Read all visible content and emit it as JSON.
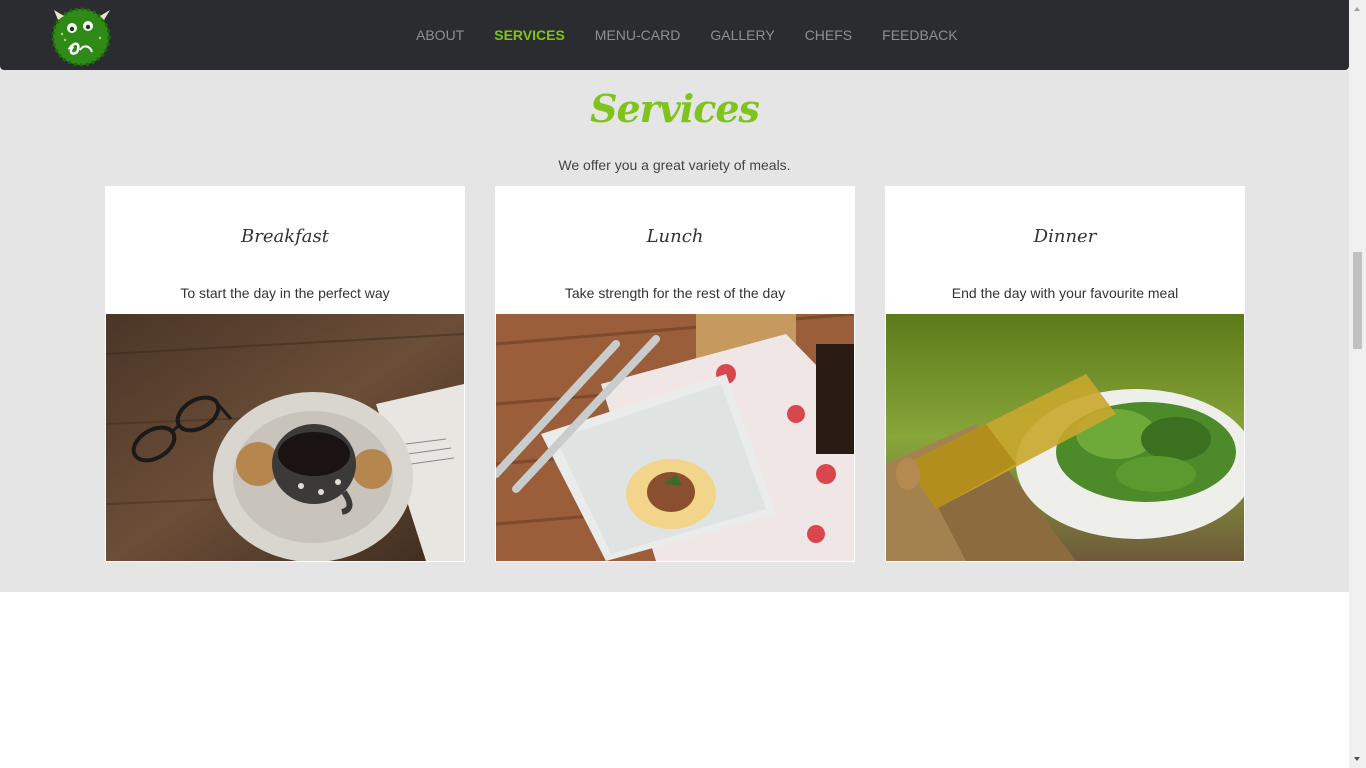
{
  "nav": {
    "logo_name": "monster-logo",
    "items": [
      {
        "label": "ABOUT",
        "active": false
      },
      {
        "label": "SERVICES",
        "active": true
      },
      {
        "label": "MENU-CARD",
        "active": false
      },
      {
        "label": "GALLERY",
        "active": false
      },
      {
        "label": "CHEFS",
        "active": false
      },
      {
        "label": "FEEDBACK",
        "active": false
      }
    ]
  },
  "services": {
    "title": "Services",
    "subtitle": "We offer you a great variety of meals.",
    "cards": [
      {
        "title": "Breakfast",
        "text": "To start the day in the perfect way",
        "image": "coffee-cup-photo"
      },
      {
        "title": "Lunch",
        "text": "Take strength for the rest of the day",
        "image": "pasta-plate-photo"
      },
      {
        "title": "Dinner",
        "text": "End the day with your favourite meal",
        "image": "salad-oil-photo"
      }
    ]
  },
  "colors": {
    "accent": "#7fc31c",
    "navbar_bg": "#2b2c30",
    "section_bg": "#e5e5e5"
  }
}
